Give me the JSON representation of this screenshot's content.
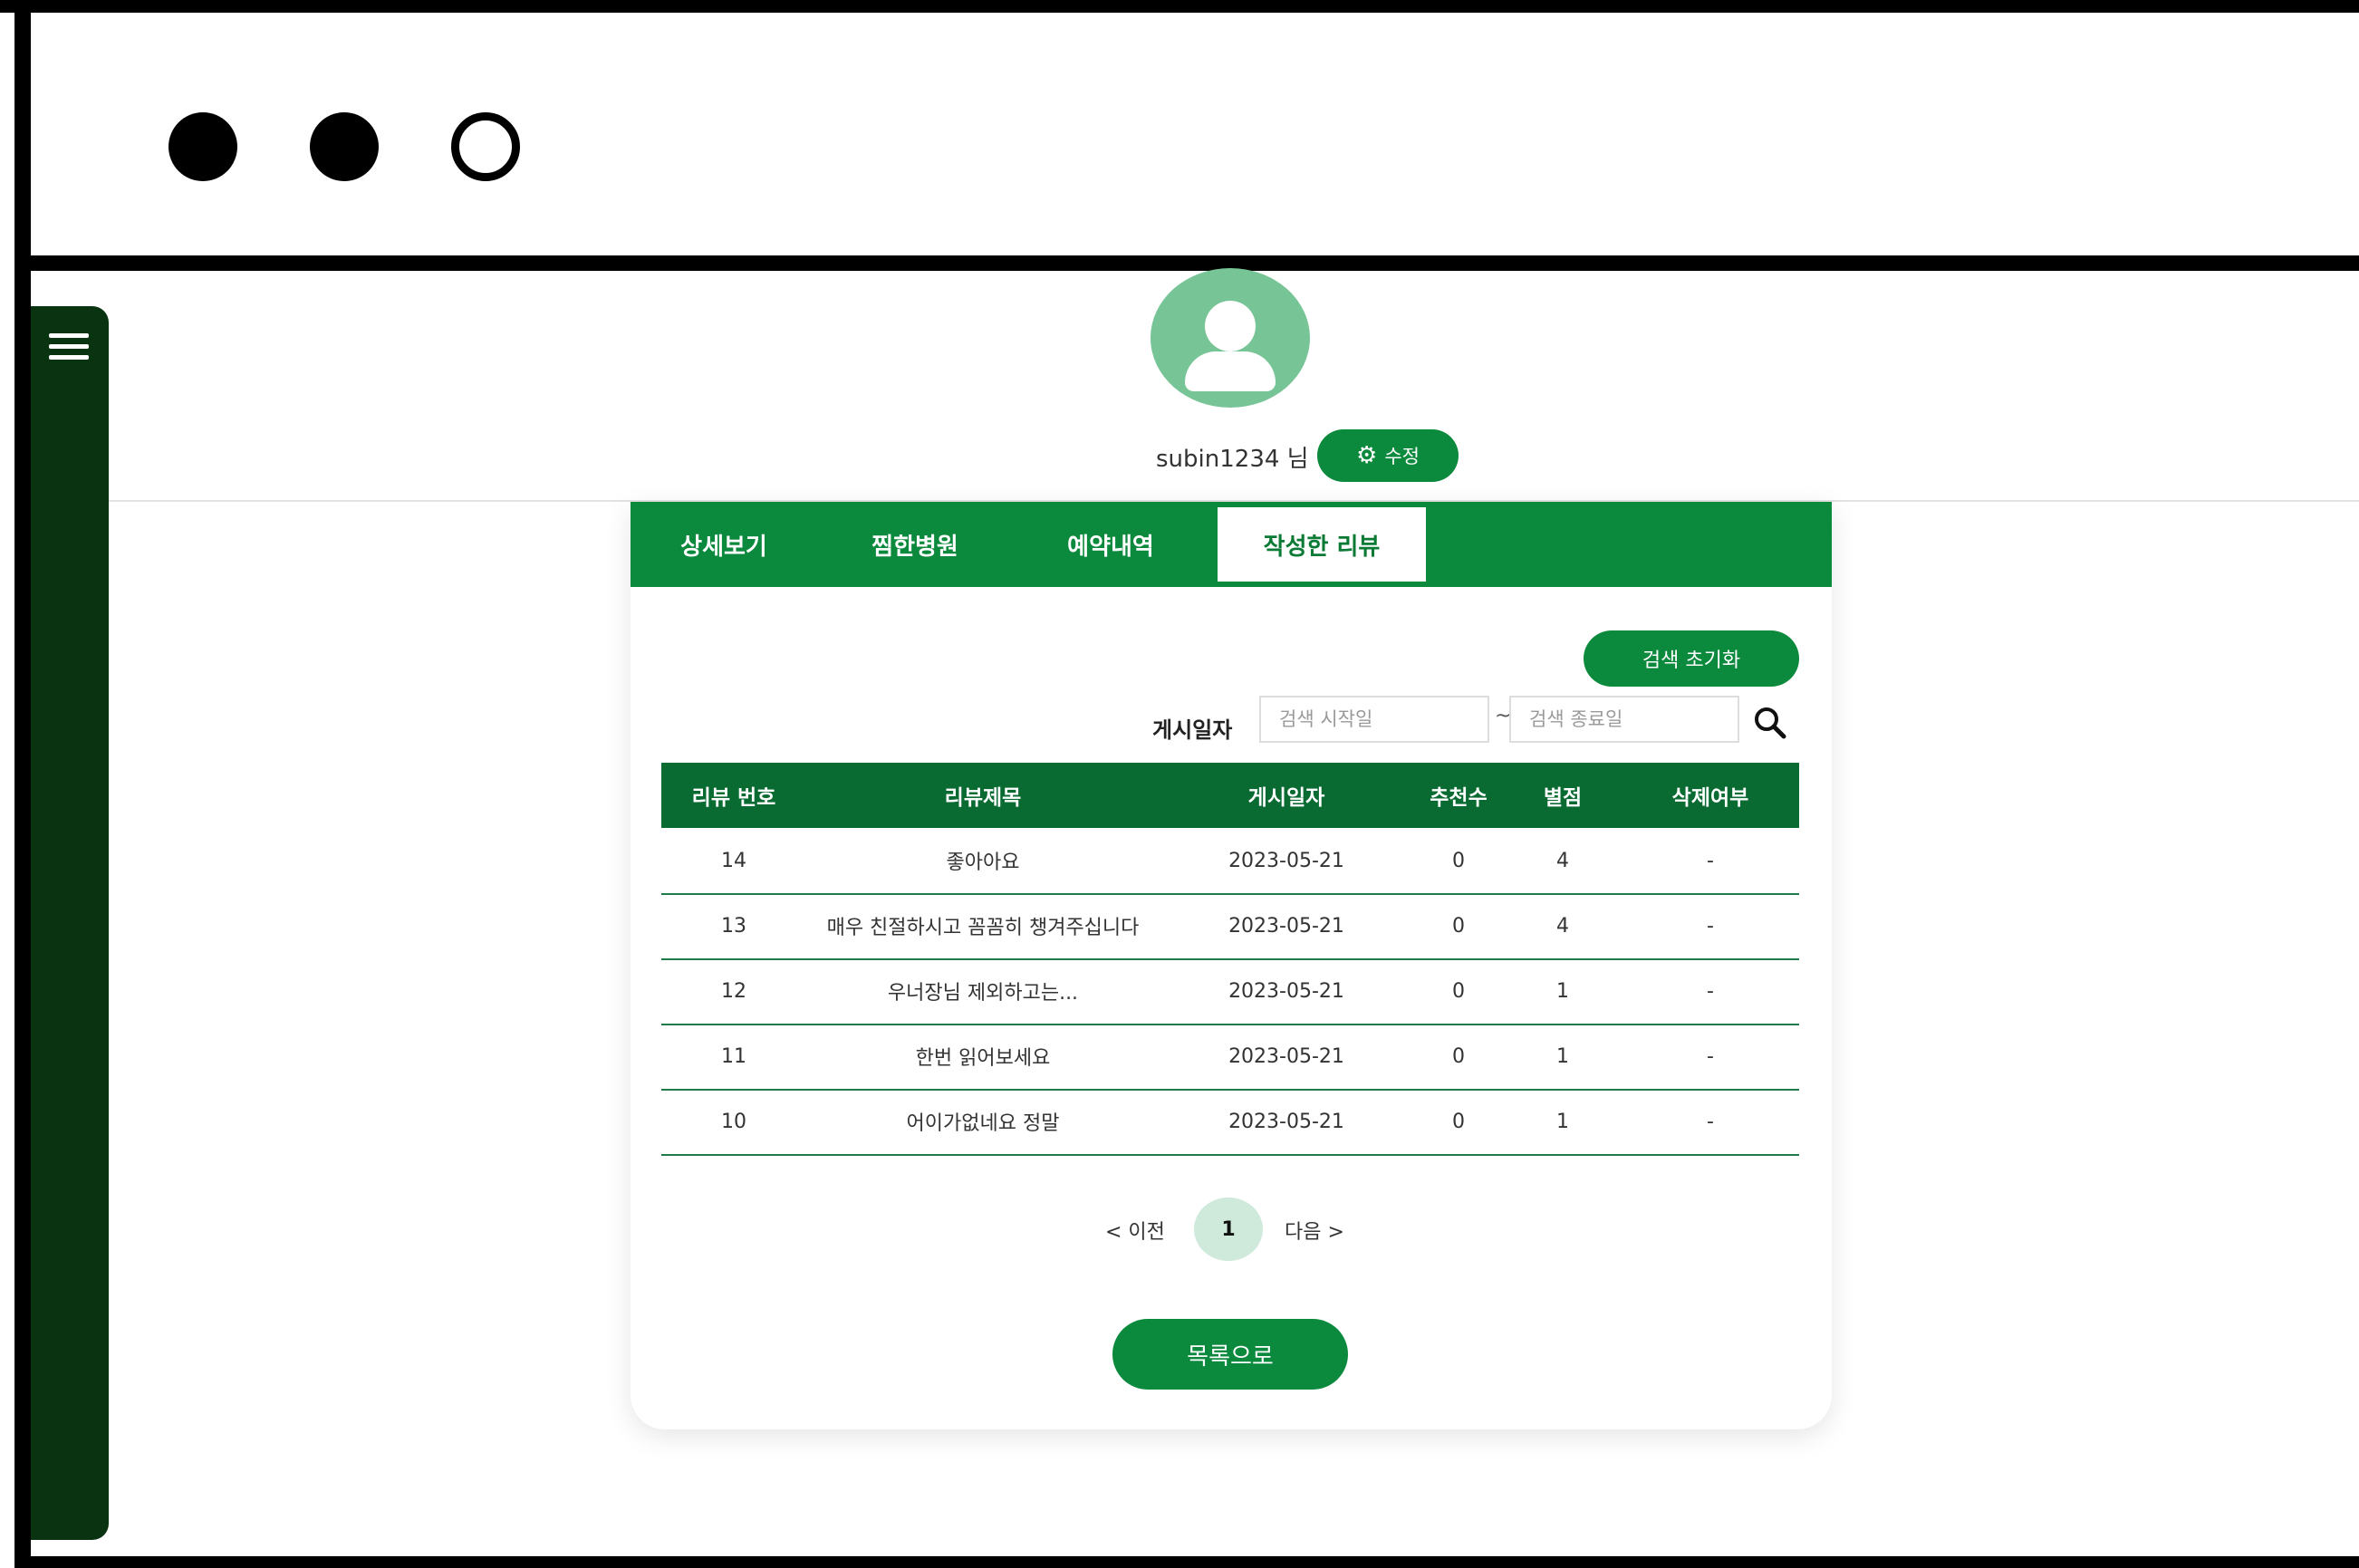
{
  "colors": {
    "brand_green": "#0b8a3d",
    "table_header": "#096b32",
    "sidebar": "#0a3311",
    "avatar_bg": "#77c496",
    "active_page_bg": "#cfe9da"
  },
  "sidebar": {
    "menu_icon": "hamburger-icon"
  },
  "profile": {
    "username": "subin1234",
    "suffix": "님",
    "edit_icon": "gear-icon",
    "edit_label": "수정"
  },
  "tabs": [
    {
      "label": "상세보기",
      "active": false
    },
    {
      "label": "찜한병원",
      "active": false
    },
    {
      "label": "예약내역",
      "active": false
    },
    {
      "label": "작성한 리뷰",
      "active": true
    }
  ],
  "filters": {
    "reset_label": "검색 초기화",
    "date_label": "게시일자",
    "start_placeholder": "검색 시작일",
    "end_placeholder": "검색 종료일",
    "separator": "~",
    "search_icon": "search-icon"
  },
  "table": {
    "headers": [
      "리뷰 번호",
      "리뷰제목",
      "게시일자",
      "추천수",
      "별점",
      "삭제여부"
    ],
    "rows": [
      [
        "14",
        "좋아아요",
        "2023-05-21",
        "0",
        "4",
        "-"
      ],
      [
        "13",
        "매우 친절하시고 꼼꼼히 챙겨주십니다",
        "2023-05-21",
        "0",
        "4",
        "-"
      ],
      [
        "12",
        "우너장님 제외하고는...",
        "2023-05-21",
        "0",
        "1",
        "-"
      ],
      [
        "11",
        "한번 읽어보세요",
        "2023-05-21",
        "0",
        "1",
        "-"
      ],
      [
        "10",
        "어이가없네요 정말",
        "2023-05-21",
        "0",
        "1",
        "-"
      ]
    ]
  },
  "pagination": {
    "prev": "< 이전",
    "current": "1",
    "next": "다음 >"
  },
  "footer": {
    "list_button": "목록으로"
  }
}
